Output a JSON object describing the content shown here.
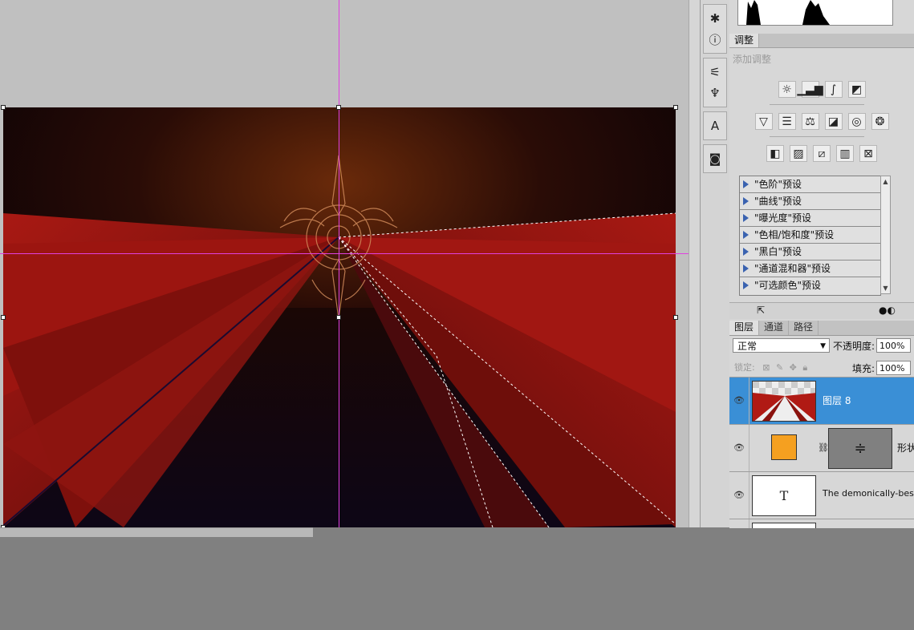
{
  "adjustments": {
    "tab_label": "调整",
    "subtitle": "添加调整",
    "row1_icons": [
      "brightness-contrast-icon",
      "levels-icon",
      "curves-icon",
      "exposure-icon"
    ],
    "row2_icons": [
      "vibrance-icon",
      "hue-saturation-icon",
      "color-balance-icon",
      "black-white-icon",
      "photo-filter-icon",
      "channel-mixer-icon"
    ],
    "row3_icons": [
      "invert-icon",
      "posterize-icon",
      "threshold-icon",
      "gradient-map-icon",
      "selective-color-icon"
    ],
    "presets": [
      "\"色阶\"预设",
      "\"曲线\"预设",
      "\"曝光度\"预设",
      "\"色相/饱和度\"预设",
      "\"黑白\"预设",
      "\"通道混和器\"预设",
      "\"可选颜色\"预设"
    ]
  },
  "layers_panel": {
    "tabs": [
      "图层",
      "通道",
      "路径"
    ],
    "blend_mode": "正常",
    "opacity_label": "不透明度:",
    "opacity_value": "100%",
    "lock_label": "锁定:",
    "fill_label": "填充:",
    "fill_value": "100%",
    "layers": [
      {
        "name": "图层 8",
        "selected": true
      },
      {
        "name": "形状",
        "selected": false
      },
      {
        "name": "The demonically-besiege",
        "selected": false
      }
    ],
    "text_thumb_glyph": "T"
  },
  "colors": {
    "selection": "#3a8fd6",
    "guide": "#e040e0",
    "shape_fill": "#f5a020"
  }
}
